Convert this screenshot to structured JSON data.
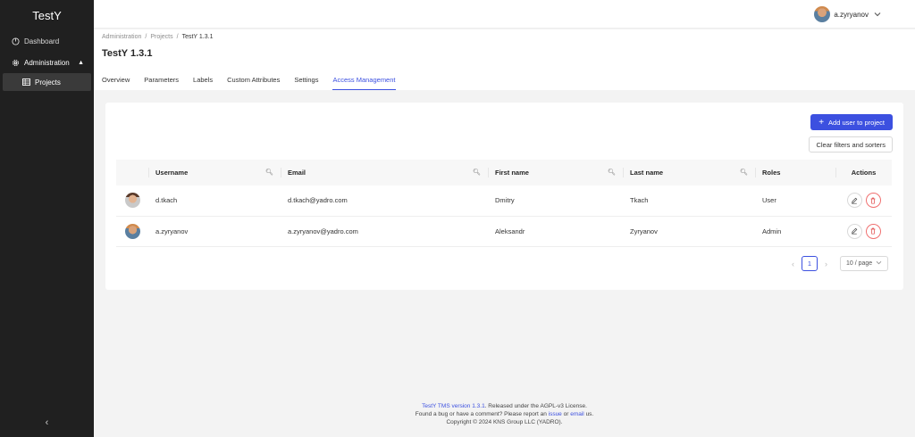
{
  "app": {
    "name": "TestY"
  },
  "sidebar": {
    "items": [
      {
        "label": "Dashboard"
      },
      {
        "label": "Administration"
      },
      {
        "label": "Projects"
      }
    ]
  },
  "header": {
    "user": "a.zyryanov"
  },
  "breadcrumb": [
    "Administration",
    "Projects",
    "TestY 1.3.1"
  ],
  "page": {
    "title": "TestY 1.3.1"
  },
  "tabs": [
    "Overview",
    "Parameters",
    "Labels",
    "Custom Attributes",
    "Settings",
    "Access Management"
  ],
  "actions": {
    "add_user": "Add user to project",
    "clear_filters": "Clear filters and sorters"
  },
  "table": {
    "columns": [
      "Username",
      "Email",
      "First name",
      "Last name",
      "Roles",
      "Actions"
    ],
    "rows": [
      {
        "username": "d.tkach",
        "email": "d.tkach@yadro.com",
        "first_name": "Dmitry",
        "last_name": "Tkach",
        "role": "User"
      },
      {
        "username": "a.zyryanov",
        "email": "a.zyryanov@yadro.com",
        "first_name": "Aleksandr",
        "last_name": "Zyryanov",
        "role": "Admin"
      }
    ]
  },
  "pagination": {
    "current": "1",
    "page_size": "10 / page"
  },
  "footer": {
    "version_link": "TestY TMS version 1.3.1",
    "line1_rest": ". Released under the AGPL-v3 License.",
    "line2_a": "Found a bug or have a comment?  Please report an ",
    "issue_link": "issue",
    "line2_b": " or ",
    "email_link": "email",
    "line2_c": " us.",
    "line3": "Copyright © 2024 KNS Group LLC (YADRO)."
  },
  "colors": {
    "accent": "#3c50e0",
    "sidebar_bg": "#202020",
    "danger": "#f07070"
  }
}
